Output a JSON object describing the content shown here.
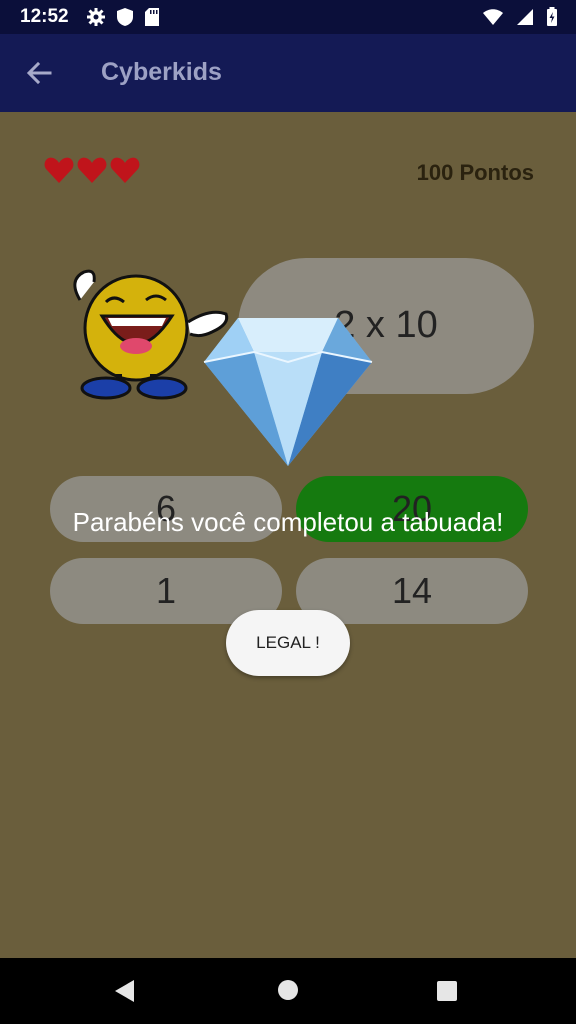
{
  "status": {
    "time": "12:52"
  },
  "appbar": {
    "title": "Cyberkids"
  },
  "game": {
    "lives": 3,
    "points": "100 Pontos",
    "question": "2 x 10",
    "answers": [
      {
        "label": "6",
        "state": "neutral"
      },
      {
        "label": "20",
        "state": "correct"
      },
      {
        "label": "1",
        "state": "neutral"
      },
      {
        "label": "14",
        "state": "neutral"
      }
    ]
  },
  "dialog": {
    "message": "Parabéns você completou a tabuada!",
    "button": "LEGAL !"
  },
  "colors": {
    "background": "#6a5e3c",
    "appbar": "#141a55",
    "correct": "#157a0f",
    "heart": "#c0141b"
  }
}
